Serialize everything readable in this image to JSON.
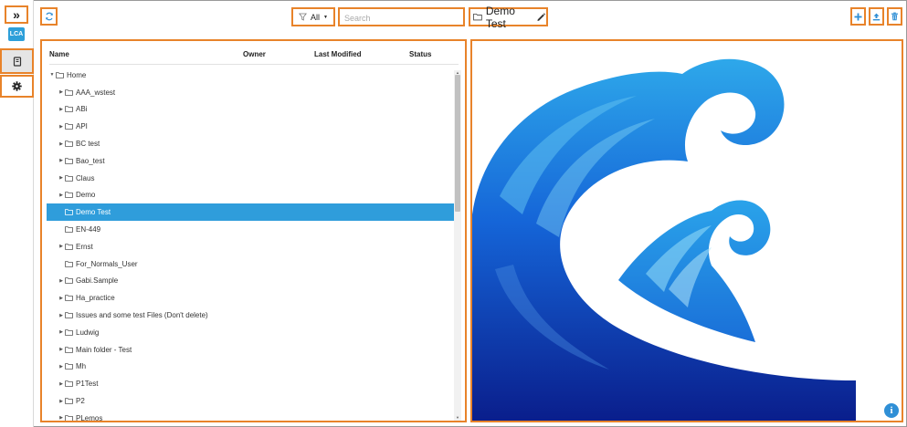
{
  "rail": {
    "expand_glyph": "»",
    "badge": "LCA",
    "icons": [
      "expand-icon",
      "book-icon",
      "gear-icon"
    ]
  },
  "toolbar": {
    "filter_value": "All",
    "search_placeholder": "Search",
    "folder_title": "Demo Test",
    "icons": [
      "refresh-icon",
      "filter-icon",
      "folder-icon",
      "pencil-icon",
      "plus-icon",
      "upload-icon",
      "trash-icon"
    ]
  },
  "tree": {
    "columns": [
      "Name",
      "Owner",
      "Last Modified",
      "Status"
    ],
    "rows": [
      {
        "label": "Home",
        "level": 0,
        "caret": "down",
        "selected": false
      },
      {
        "label": "AAA_wstest",
        "level": 1,
        "caret": "right",
        "selected": false
      },
      {
        "label": "ABi",
        "level": 1,
        "caret": "right",
        "selected": false
      },
      {
        "label": "API",
        "level": 1,
        "caret": "right",
        "selected": false
      },
      {
        "label": "BC test",
        "level": 1,
        "caret": "right",
        "selected": false
      },
      {
        "label": "Bao_test",
        "level": 1,
        "caret": "right",
        "selected": false
      },
      {
        "label": "Claus",
        "level": 1,
        "caret": "right",
        "selected": false
      },
      {
        "label": "Demo",
        "level": 1,
        "caret": "right",
        "selected": false
      },
      {
        "label": "Demo Test",
        "level": 1,
        "caret": "none",
        "selected": true
      },
      {
        "label": "EN-449",
        "level": 1,
        "caret": "none",
        "selected": false
      },
      {
        "label": "Ernst",
        "level": 1,
        "caret": "right",
        "selected": false
      },
      {
        "label": "For_Normals_User",
        "level": 1,
        "caret": "none",
        "selected": false
      },
      {
        "label": "Gabi.Sample",
        "level": 1,
        "caret": "right",
        "selected": false
      },
      {
        "label": "Ha_practice",
        "level": 1,
        "caret": "right",
        "selected": false
      },
      {
        "label": "Issues and some test Files (Don't delete)",
        "level": 1,
        "caret": "right",
        "selected": false
      },
      {
        "label": "Ludwig",
        "level": 1,
        "caret": "right",
        "selected": false
      },
      {
        "label": "Main folder - Test",
        "level": 1,
        "caret": "right",
        "selected": false
      },
      {
        "label": "Mh",
        "level": 1,
        "caret": "right",
        "selected": false
      },
      {
        "label": "P1Test",
        "level": 1,
        "caret": "right",
        "selected": false
      },
      {
        "label": "P2",
        "level": 1,
        "caret": "right",
        "selected": false
      },
      {
        "label": "PLemos",
        "level": 1,
        "caret": "right",
        "selected": false
      }
    ]
  },
  "preview": {
    "info_glyph": "i"
  },
  "colors": {
    "accent": "#2f9ddb",
    "highlight": "#e8832a",
    "wave_light": "#2ea8ea",
    "wave_dark": "#0a1e8c"
  }
}
